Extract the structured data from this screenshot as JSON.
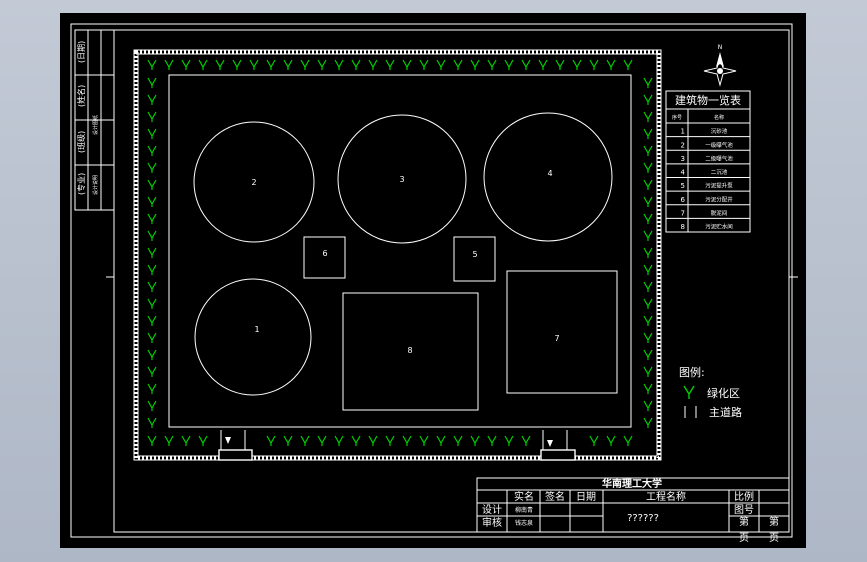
{
  "compass": {
    "north_label": "N"
  },
  "side_strip": {
    "labels": [
      "(专业)",
      "(班级)",
      "(姓名)",
      "(日期)"
    ],
    "small_labels": [
      "设计说明",
      "设计图纸"
    ]
  },
  "buildings": [
    {
      "id": "2",
      "shape": "circle"
    },
    {
      "id": "3",
      "shape": "circle"
    },
    {
      "id": "4",
      "shape": "circle"
    },
    {
      "id": "1",
      "shape": "circle"
    },
    {
      "id": "6",
      "shape": "rect"
    },
    {
      "id": "5",
      "shape": "rect"
    },
    {
      "id": "8",
      "shape": "rect"
    },
    {
      "id": "7",
      "shape": "rect"
    }
  ],
  "building_table": {
    "title": "建筑物一览表",
    "headers": [
      "序号",
      "名称"
    ],
    "rows": [
      [
        "1",
        "沉砂池"
      ],
      [
        "2",
        "一级曝气池"
      ],
      [
        "3",
        "二级曝气池"
      ],
      [
        "4",
        "二沉池"
      ],
      [
        "5",
        "污泥提升泵"
      ],
      [
        "6",
        "污泥分配井"
      ],
      [
        "7",
        "脱泥间"
      ],
      [
        "8",
        "污泥贮水间"
      ]
    ]
  },
  "legend": {
    "title": "图例:",
    "items": [
      {
        "symbol": "green-arrow",
        "label": "绿化区",
        "color": "#00d000"
      },
      {
        "symbol": "double-line",
        "label": "主道路",
        "color": "#ffffff"
      }
    ]
  },
  "title_block": {
    "university": "华南理工大学",
    "col_headers": [
      "实名",
      "签名",
      "日期"
    ],
    "project_header": "工程名称",
    "scale_label": "比例",
    "drawing_no_label": "图号",
    "project_value": "??????",
    "rows": [
      {
        "role": "设计",
        "name": "柳南青"
      },
      {
        "role": "审核",
        "name": "钱志泉"
      }
    ],
    "page_labels": [
      "第",
      "第"
    ],
    "page_suffix": [
      "页",
      "页"
    ]
  },
  "colors": {
    "greenery": "#00d000",
    "background": "#000000",
    "lines": "#ffffff"
  }
}
